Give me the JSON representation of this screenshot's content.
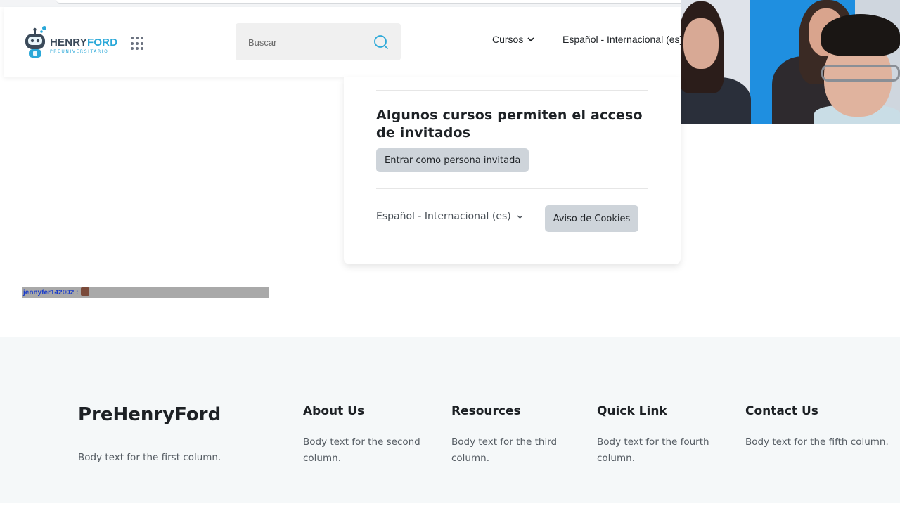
{
  "header": {
    "logo": {
      "brand_first": "HENRY",
      "brand_second": "FORD",
      "tagline": "PREUNIVERSITARIO"
    },
    "search": {
      "placeholder": "Buscar"
    },
    "nav": {
      "courses_label": "Cursos",
      "language_label": "Español - Internacional (es)"
    }
  },
  "login_card": {
    "guest_title": "Algunos cursos permiten el acceso de invitados",
    "guest_button": "Entrar como persona invitada",
    "language_select": "Español - Internacional (es)",
    "cookie_button": "Aviso de Cookies"
  },
  "chat": {
    "message": "jennyfer142002 :"
  },
  "footer": {
    "brand": "PreHenryFord",
    "columns": [
      {
        "heading": "",
        "body": "Body text for the first column."
      },
      {
        "heading": "About Us",
        "body": "Body text for the second column."
      },
      {
        "heading": "Resources",
        "body": "Body text for the third column."
      },
      {
        "heading": "Quick Link",
        "body": "Body text for the fourth column."
      },
      {
        "heading": "Contact Us",
        "body": "Body text for the fifth column."
      }
    ]
  },
  "colors": {
    "accent": "#2aa8d8",
    "button_bg": "#ced4da",
    "footer_bg": "#f5f8f9",
    "text": "#1d2125"
  },
  "icons": [
    "robot-logo-icon",
    "apps-grid-icon",
    "search-icon",
    "chevron-down-icon"
  ]
}
